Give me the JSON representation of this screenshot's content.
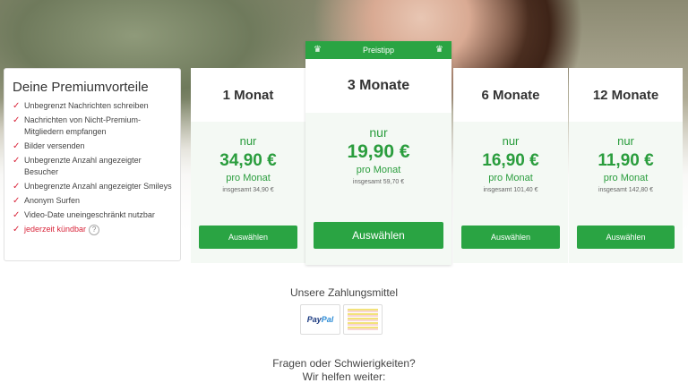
{
  "benefits": {
    "title": "Deine Premiumvorteile",
    "items": [
      "Unbegrenzt Nachrichten schreiben",
      "Nachrichten von Nicht-Premium-Mitgliedern empfangen",
      "Bilder versenden",
      "Unbegrenzte Anzahl angezeigter Besucher",
      "Unbegrenzte Anzahl angezeigter Smileys",
      "Anonym Surfen",
      "Video-Date uneingeschränkt nutzbar"
    ],
    "cancel": "jederzeit kündbar",
    "help_icon": "?",
    "check_icon": "✓"
  },
  "plans": [
    {
      "name": "1 Monat",
      "nur": "nur",
      "price": "34,90 €",
      "per": "pro Monat",
      "total": "insgesamt 34,90 €",
      "button": "Auswählen"
    },
    {
      "name": "3 Monate",
      "nur": "nur",
      "price": "19,90 €",
      "per": "pro Monat",
      "total": "insgesamt 59,70 €",
      "button": "Auswählen",
      "badge": "Preistipp"
    },
    {
      "name": "6 Monate",
      "nur": "nur",
      "price": "16,90 €",
      "per": "pro Monat",
      "total": "insgesamt 101,40 €",
      "button": "Auswählen"
    },
    {
      "name": "12 Monate",
      "nur": "nur",
      "price": "11,90 €",
      "per": "pro Monat",
      "total": "insgesamt 142,80 €",
      "button": "Auswählen"
    }
  ],
  "payment": {
    "title": "Unsere Zahlungsmittel",
    "paypal_a": "Pay",
    "paypal_b": "Pal"
  },
  "help": {
    "line1": "Fragen oder Schwierigkeiten?",
    "line2": "Wir helfen weiter:"
  },
  "colors": {
    "accent_green": "#2aa443",
    "check_red": "#d9273c"
  }
}
